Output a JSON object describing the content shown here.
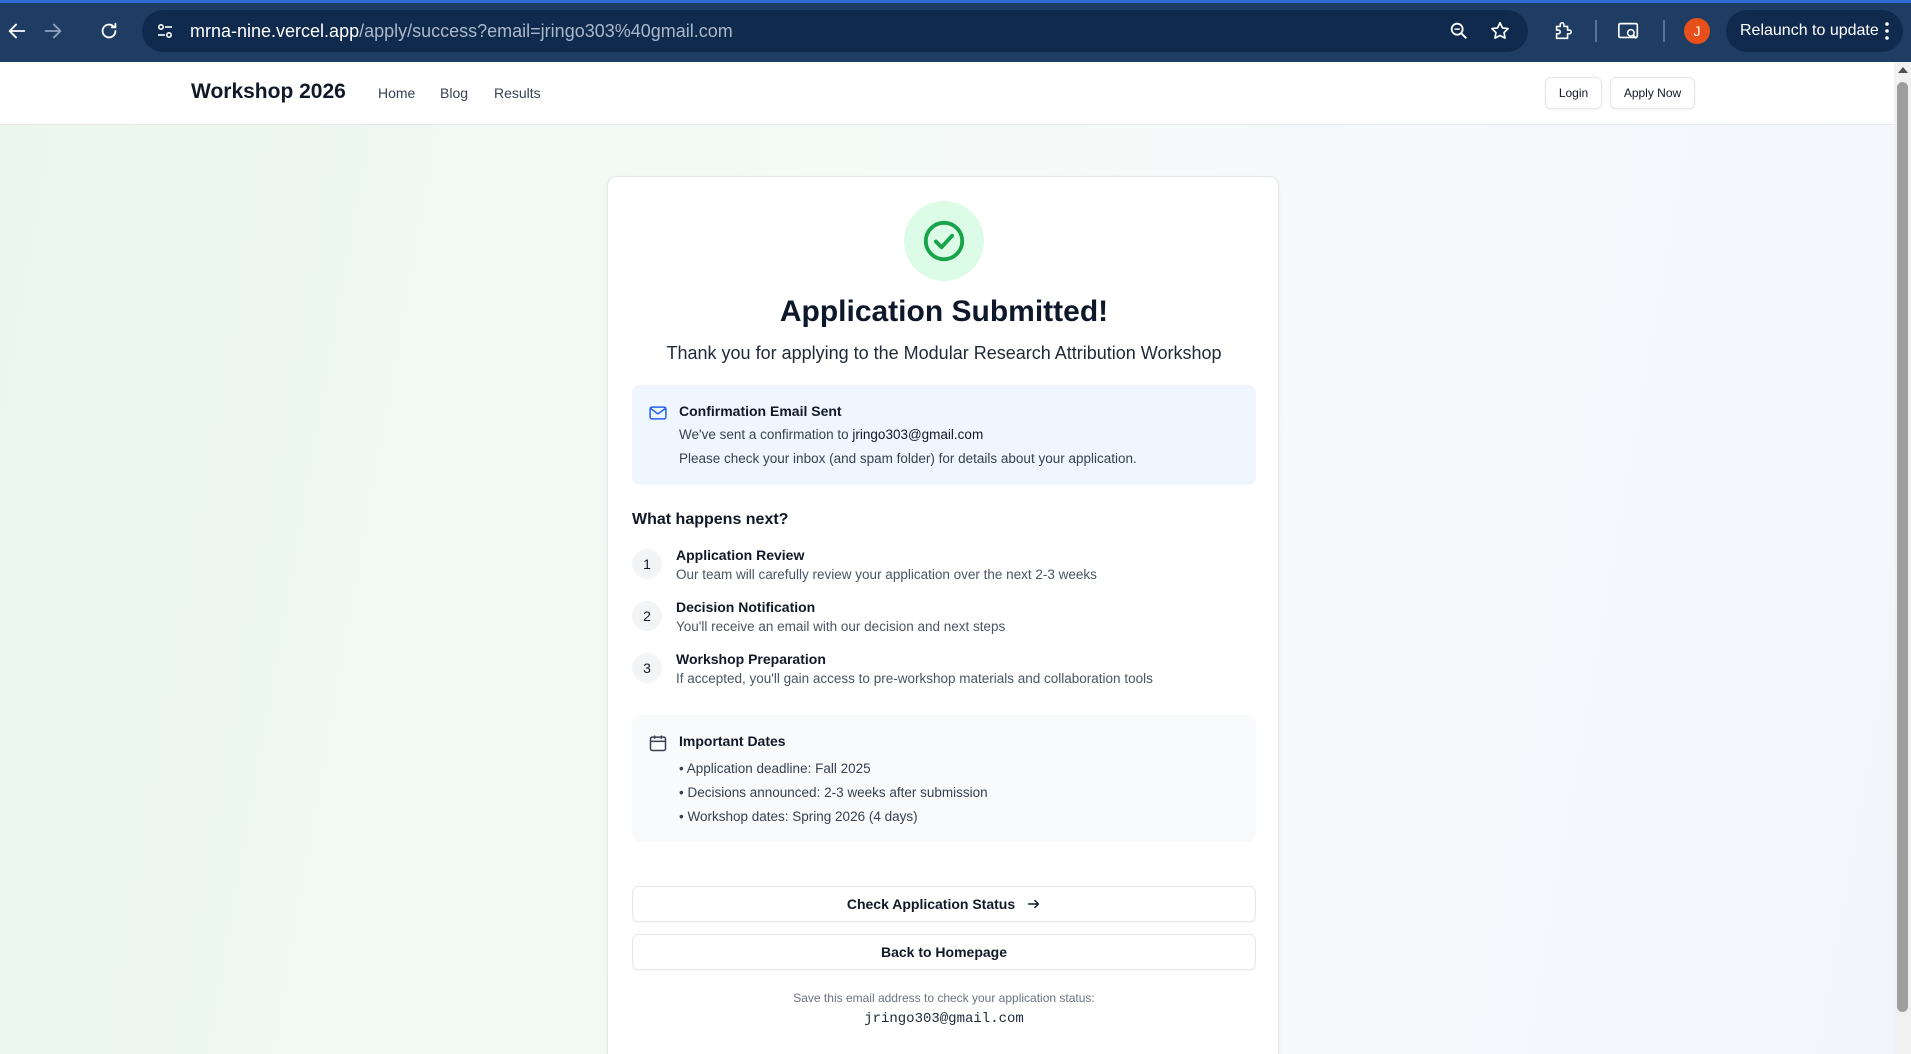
{
  "browser": {
    "url_host": "mrna-nine.vercel.app",
    "url_path": "/apply/success?email=jringo303%40gmail.com",
    "profile_initial": "J",
    "relaunch_label": "Relaunch to update"
  },
  "header": {
    "brand": "Workshop 2026",
    "nav": [
      "Home",
      "Blog",
      "Results"
    ],
    "login_label": "Login",
    "apply_label": "Apply Now"
  },
  "main": {
    "title": "Application Submitted!",
    "subtitle": "Thank you for applying to the Modular Research Attribution Workshop",
    "confirmation": {
      "title": "Confirmation Email Sent",
      "line1_prefix": "We've sent a confirmation to ",
      "email": "jringo303@gmail.com",
      "line2": "Please check your inbox (and spam folder) for details about your application."
    },
    "next_title": "What happens next?",
    "steps": [
      {
        "num": "1",
        "title": "Application Review",
        "desc": "Our team will carefully review your application over the next 2-3 weeks"
      },
      {
        "num": "2",
        "title": "Decision Notification",
        "desc": "You'll receive an email with our decision and next steps"
      },
      {
        "num": "3",
        "title": "Workshop Preparation",
        "desc": "If accepted, you'll gain access to pre-workshop materials and collaboration tools"
      }
    ],
    "dates": {
      "title": "Important Dates",
      "items": [
        "• Application deadline: Fall 2025",
        "• Decisions announced: 2-3 weeks after submission",
        "• Workshop dates: Spring 2026 (4 days)"
      ]
    },
    "check_status_label": "Check Application Status",
    "back_home_label": "Back to Homepage",
    "save_note": "Save this email address to check your application status:",
    "save_email": "jringo303@gmail.com"
  },
  "colors": {
    "success": "#16a34a",
    "info_bg": "#eff6ff",
    "info_icon": "#2563eb",
    "chrome": "#1f3d63"
  },
  "icons": [
    "back-arrow-icon",
    "forward-arrow-icon",
    "reload-icon",
    "site-info-icon",
    "zoom-icon",
    "star-icon",
    "extensions-icon",
    "cast-icon",
    "menu-dots-icon",
    "check-circle-icon",
    "mail-icon",
    "calendar-icon",
    "arrow-right-icon"
  ]
}
